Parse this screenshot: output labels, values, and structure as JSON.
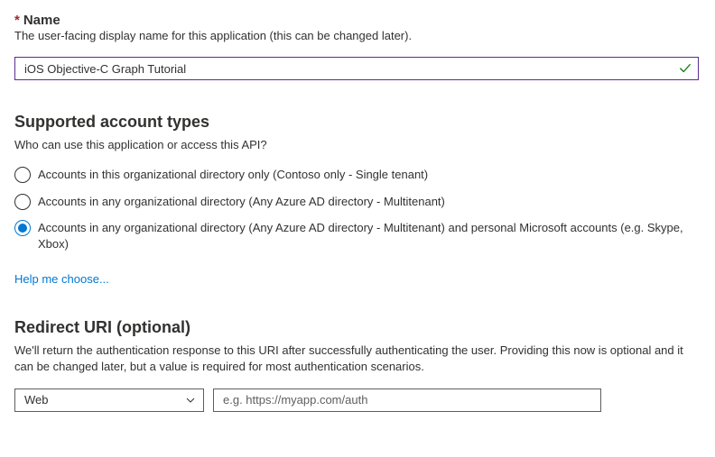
{
  "name_section": {
    "required_star": "*",
    "label": "Name",
    "description": "The user-facing display name for this application (this can be changed later).",
    "value": "iOS Objective-C Graph Tutorial"
  },
  "account_types_section": {
    "title": "Supported account types",
    "description": "Who can use this application or access this API?",
    "options": [
      {
        "label": "Accounts in this organizational directory only (Contoso only - Single tenant)",
        "selected": false
      },
      {
        "label": "Accounts in any organizational directory (Any Azure AD directory - Multitenant)",
        "selected": false
      },
      {
        "label": "Accounts in any organizational directory (Any Azure AD directory - Multitenant) and personal Microsoft accounts (e.g. Skype, Xbox)",
        "selected": true
      }
    ],
    "help_link": "Help me choose..."
  },
  "redirect_section": {
    "title": "Redirect URI (optional)",
    "description": "We'll return the authentication response to this URI after successfully authenticating the user. Providing this now is optional and it can be changed later, but a value is required for most authentication scenarios.",
    "platform_value": "Web",
    "uri_placeholder": "e.g. https://myapp.com/auth",
    "uri_value": ""
  }
}
